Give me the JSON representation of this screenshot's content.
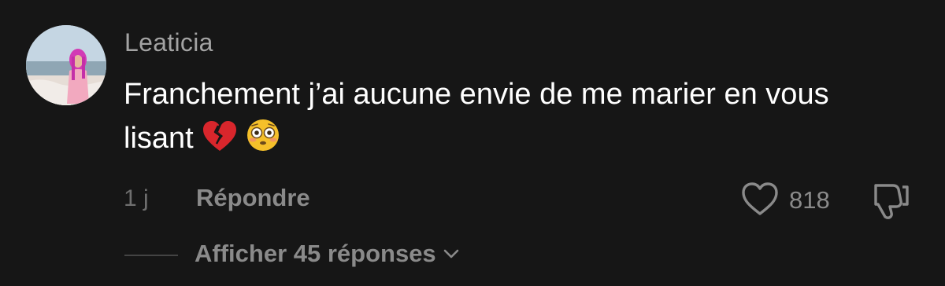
{
  "comment": {
    "username": "Leaticia",
    "text": "Franchement j’ai aucune envie de me marier en vous lisant",
    "emojis": [
      "broken-heart-icon",
      "flushed-face-icon"
    ],
    "timestamp": "1 j",
    "reply_label": "Répondre",
    "like_count": "818",
    "view_replies_label": "Afficher 45 réponses"
  },
  "colors": {
    "background": "#161616",
    "username": "#a3a3a3",
    "text": "#ffffff",
    "muted": "#8a8a8a",
    "broken_heart": "#d9262c",
    "emoji_face": "#f5c02a"
  }
}
